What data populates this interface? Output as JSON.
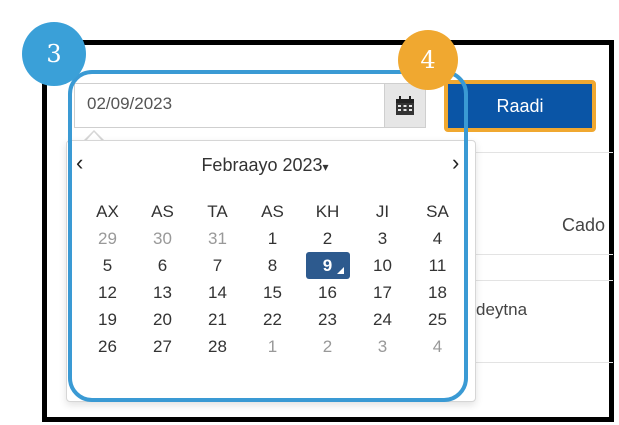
{
  "annotations": {
    "step_a": "3",
    "step_b": "4",
    "ring_color": "#3a9ad4",
    "badge_b_color": "#f0a830"
  },
  "date_field": {
    "value": "02/09/2023",
    "calendar_icon": "calendar-icon"
  },
  "search_button": {
    "label": "Raadi",
    "color": "#0a55a6"
  },
  "datepicker": {
    "prev": "‹",
    "next": "›",
    "month_label": "Febraayo 2023",
    "month_caret": "▾",
    "weekdays": [
      "AX",
      "AS",
      "TA",
      "AS",
      "KH",
      "JI",
      "SA"
    ],
    "weeks": [
      [
        "29",
        "30",
        "31",
        "1",
        "2",
        "3",
        "4"
      ],
      [
        "5",
        "6",
        "7",
        "8",
        "9",
        "10",
        "11"
      ],
      [
        "12",
        "13",
        "14",
        "15",
        "16",
        "17",
        "18"
      ],
      [
        "19",
        "20",
        "21",
        "22",
        "23",
        "24",
        "25"
      ],
      [
        "26",
        "27",
        "28",
        "1",
        "2",
        "3",
        "4"
      ]
    ],
    "selected_day": "9",
    "selected_color": "#2d5a8e"
  },
  "table": {
    "column_header_partial": "Cado",
    "cell_partial": "deytna"
  }
}
